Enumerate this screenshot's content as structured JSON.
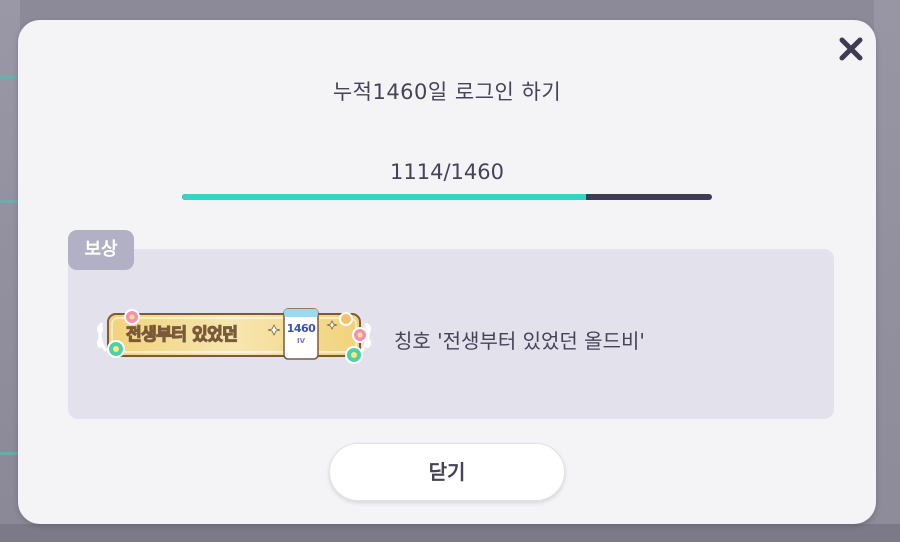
{
  "dialog": {
    "title": "누적1460일 로그인 하기",
    "progress": {
      "text": "1114/1460",
      "current": 1114,
      "total": 1460
    },
    "reward": {
      "tag_label": "보상",
      "badge_text": "전생부터 있었던",
      "badge_calendar_number": "1460",
      "badge_calendar_sub": "IV",
      "name": "칭호 '전생부터 있었던 올드비'"
    },
    "close_button_label": "닫기"
  },
  "colors": {
    "accent": "#33d6c6",
    "bar_track": "#3f3b54",
    "text": "#454358",
    "reward_box": "#e2e1ec",
    "reward_tag": "#b2b0c4"
  },
  "icons": {
    "close": "close-x-icon"
  }
}
